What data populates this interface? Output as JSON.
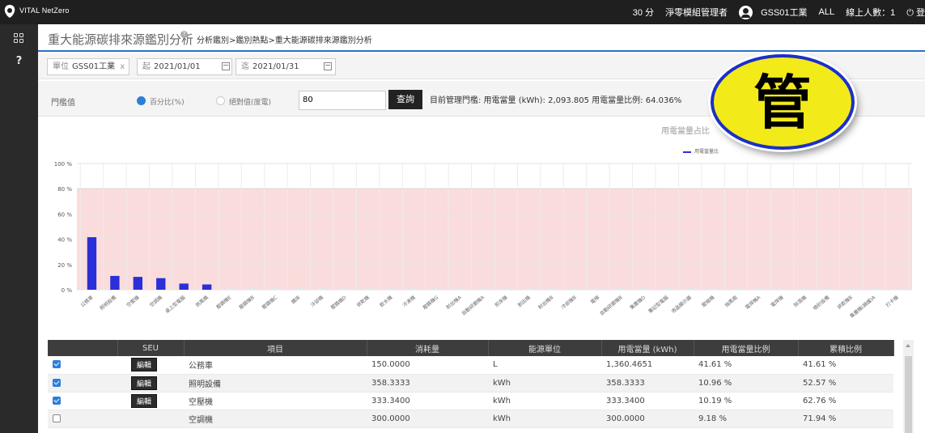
{
  "app": {
    "brand": "VITAL NetZero"
  },
  "topbar": {
    "timer": "30 分",
    "role": "淨零模組管理者",
    "org": "GSS01工業",
    "scope": "ALL",
    "online": "線上人數：1",
    "logout": "⏻ 登"
  },
  "sidebar": {
    "help_label": "?"
  },
  "page": {
    "title": "重大能源碳排來源鑑別分析",
    "help": "?",
    "breadcrumb": "分析鑑別>鑑別熱點>重大能源碳排來源鑑別分析"
  },
  "filters": {
    "unit_label": "單位",
    "unit_value": "GSS01工業",
    "unit_clear": "x",
    "from_label": "起",
    "from_value": "2021/01/01",
    "to_label": "迄",
    "to_value": "2021/01/31",
    "threshold_label": "門檻值",
    "option_percent": "百分比(%)",
    "option_absolute": "絕對值(度電)",
    "threshold_value": "80",
    "query_button": "查詢",
    "threshold_info": "目前管理門檻: 用電當量 (kWh): 2,093.805 用電當量比例: 64.036%"
  },
  "chart_data": {
    "type": "bar",
    "title": "用電當量占比",
    "legend": [
      "用電當量比"
    ],
    "ylim": [
      0,
      100
    ],
    "yticks": [
      "100 %",
      "80 %",
      "60 %",
      "40 %",
      "20 %",
      "0 %"
    ],
    "threshold_band": [
      0,
      80
    ],
    "categories": [
      "公務車",
      "照明設備",
      "空壓機",
      "空調機",
      "桌上型電腦",
      "熱風機",
      "壓鑄機E",
      "壓鑄機B",
      "壓鑄機C",
      "鑽床",
      "冷卻機",
      "壓鑄機D",
      "烘乾機",
      "飲水機",
      "冷凍機",
      "壓鑄機G",
      "射出機A",
      "自動研磨機A",
      "剪床機",
      "割出機",
      "射出機B",
      "冷卻機B",
      "電梯",
      "自動研磨機B",
      "集塵機D",
      "筆記型電腦",
      "液晶顯示器",
      "壓縮機",
      "抽風扇",
      "電焊機A",
      "電焊機",
      "除濕機",
      "噴砂設備",
      "烘乾機B",
      "集塵機(鍋爐)A",
      "打卡機"
    ],
    "values": [
      41.61,
      10.96,
      10.19,
      9.18,
      4.9,
      4.2,
      0.9,
      0.8,
      0.7,
      0.6,
      0.55,
      0.5,
      0.45,
      0.4,
      0.35,
      0.3,
      0.25,
      0.2,
      0.18,
      0.16,
      0.15,
      0.14,
      0.13,
      0.12,
      0.11,
      0.1,
      0.09,
      0.08,
      0.07,
      0.06,
      0.05,
      0.05,
      0.04,
      0.04,
      0.03,
      0.03
    ],
    "colors": {
      "main": "#2a2fd8",
      "minor": "#e6e6e6",
      "band": "#fbdcdc",
      "band_line": "#e99a9a"
    }
  },
  "table": {
    "columns": [
      "",
      "SEU",
      "項目",
      "消耗量",
      "能源單位",
      "用電當量 (kWh)",
      "用電當量比例",
      "累積比例"
    ],
    "edit_label": "編輯",
    "rows": [
      {
        "checked": true,
        "item": "公務車",
        "consumption": "150.0000",
        "unit": "L",
        "kwh": "1,360.4651",
        "ratio": "41.61 %",
        "cumulative": "41.61 %"
      },
      {
        "checked": true,
        "item": "照明設備",
        "consumption": "358.3333",
        "unit": "kWh",
        "kwh": "358.3333",
        "ratio": "10.96 %",
        "cumulative": "52.57 %"
      },
      {
        "checked": true,
        "item": "空壓機",
        "consumption": "333.3400",
        "unit": "kWh",
        "kwh": "333.3400",
        "ratio": "10.19 %",
        "cumulative": "62.76 %"
      },
      {
        "checked": false,
        "item": "空調機",
        "consumption": "300.0000",
        "unit": "kWh",
        "kwh": "300.0000",
        "ratio": "9.18 %",
        "cumulative": "71.94 %"
      }
    ]
  },
  "badge": {
    "text": "管"
  }
}
